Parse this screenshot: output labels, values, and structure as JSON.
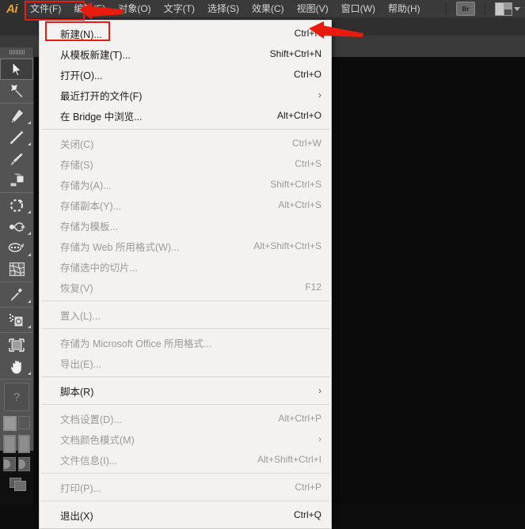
{
  "app": {
    "name": "Ai",
    "brand_color": "#f0a030",
    "highlight_color": "#e81b0e"
  },
  "menubar": {
    "items": [
      {
        "label": "文件(F)",
        "active": true
      },
      {
        "label": "编辑(E)",
        "active": false
      },
      {
        "label": "对象(O)",
        "active": false
      },
      {
        "label": "文字(T)",
        "active": false
      },
      {
        "label": "选择(S)",
        "active": false
      },
      {
        "label": "效果(C)",
        "active": false
      },
      {
        "label": "视图(V)",
        "active": false
      },
      {
        "label": "窗口(W)",
        "active": false
      },
      {
        "label": "帮助(H)",
        "active": false
      }
    ],
    "bridge_button": "Br",
    "workspace_icon": "layout-switcher-icon",
    "workspace_caret": "chevron-down-icon"
  },
  "file_menu": {
    "title": "文件(F)",
    "groups": [
      {
        "items": [
          {
            "label": "新建(N)...",
            "accel": "Ctrl+N",
            "state": "enabled",
            "submenu": false,
            "highlighted": true
          },
          {
            "label": "从模板新建(T)...",
            "accel": "Shift+Ctrl+N",
            "state": "enabled",
            "submenu": false
          },
          {
            "label": "打开(O)...",
            "accel": "Ctrl+O",
            "state": "enabled",
            "submenu": false
          },
          {
            "label": "最近打开的文件(F)",
            "accel": "",
            "state": "enabled",
            "submenu": true
          },
          {
            "label": "在 Bridge 中浏览...",
            "accel": "Alt+Ctrl+O",
            "state": "enabled",
            "submenu": false
          }
        ]
      },
      {
        "items": [
          {
            "label": "关闭(C)",
            "accel": "Ctrl+W",
            "state": "disabled",
            "submenu": false
          },
          {
            "label": "存储(S)",
            "accel": "Ctrl+S",
            "state": "disabled",
            "submenu": false
          },
          {
            "label": "存储为(A)...",
            "accel": "Shift+Ctrl+S",
            "state": "disabled",
            "submenu": false
          },
          {
            "label": "存储副本(Y)...",
            "accel": "Alt+Ctrl+S",
            "state": "disabled",
            "submenu": false
          },
          {
            "label": "存储为模板...",
            "accel": "",
            "state": "disabled",
            "submenu": false
          },
          {
            "label": "存储为 Web 所用格式(W)...",
            "accel": "Alt+Shift+Ctrl+S",
            "state": "disabled",
            "submenu": false
          },
          {
            "label": "存储选中的切片...",
            "accel": "",
            "state": "disabled",
            "submenu": false
          },
          {
            "label": "恢复(V)",
            "accel": "F12",
            "state": "disabled",
            "submenu": false
          }
        ]
      },
      {
        "items": [
          {
            "label": "置入(L)...",
            "accel": "",
            "state": "disabled",
            "submenu": false
          }
        ]
      },
      {
        "items": [
          {
            "label": "存储为 Microsoft Office 所用格式...",
            "accel": "",
            "state": "disabled",
            "submenu": false
          },
          {
            "label": "导出(E)...",
            "accel": "",
            "state": "disabled",
            "submenu": false
          }
        ]
      },
      {
        "items": [
          {
            "label": "脚本(R)",
            "accel": "",
            "state": "enabled",
            "submenu": true
          }
        ]
      },
      {
        "items": [
          {
            "label": "文档设置(D)...",
            "accel": "Alt+Ctrl+P",
            "state": "disabled",
            "submenu": false
          },
          {
            "label": "文档颜色模式(M)",
            "accel": "",
            "state": "disabled",
            "submenu": true
          },
          {
            "label": "文件信息(I)...",
            "accel": "Alt+Shift+Ctrl+I",
            "state": "disabled",
            "submenu": false
          }
        ]
      },
      {
        "items": [
          {
            "label": "打印(P)...",
            "accel": "Ctrl+P",
            "state": "disabled",
            "submenu": false
          }
        ]
      },
      {
        "items": [
          {
            "label": "退出(X)",
            "accel": "Ctrl+Q",
            "state": "enabled",
            "submenu": false
          }
        ]
      }
    ]
  },
  "toolbar": {
    "groups": [
      {
        "tools": [
          {
            "name": "selection-tool",
            "selected": true,
            "corner": false
          },
          {
            "name": "magic-wand-tool",
            "selected": false,
            "corner": false
          }
        ]
      },
      {
        "tools": [
          {
            "name": "pen-tool",
            "selected": false,
            "corner": true
          },
          {
            "name": "line-segment-tool",
            "selected": false,
            "corner": true
          },
          {
            "name": "paintbrush-tool",
            "selected": false,
            "corner": false
          },
          {
            "name": "shape-builder-tool",
            "selected": false,
            "corner": false
          }
        ]
      },
      {
        "tools": [
          {
            "name": "rotate-tool",
            "selected": false,
            "corner": true
          },
          {
            "name": "width-tool",
            "selected": false,
            "corner": true
          },
          {
            "name": "blend-tool",
            "selected": false,
            "corner": true
          },
          {
            "name": "mesh-tool",
            "selected": false,
            "corner": false
          }
        ]
      },
      {
        "tools": [
          {
            "name": "eyedropper-tool",
            "selected": false,
            "corner": true
          }
        ]
      },
      {
        "tools": [
          {
            "name": "symbol-sprayer-tool",
            "selected": false,
            "corner": true
          }
        ]
      },
      {
        "tools": [
          {
            "name": "artboard-tool",
            "selected": false,
            "corner": false
          },
          {
            "name": "hand-tool",
            "selected": false,
            "corner": true
          }
        ]
      }
    ],
    "help_icon": "question-mark-icon",
    "fill_stroke": "fill-stroke-swatches",
    "color_modes": "color-mode-buttons",
    "screen_mode": "screen-mode-button"
  },
  "annotations": {
    "file_menu_highlight": "red-rectangle-around-file-menu",
    "new_item_highlight": "red-rectangle-around-new-item",
    "arrow_menubar": "red-arrow-pointing-to-file-menu",
    "arrow_shortcut": "red-arrow-pointing-to-ctrl-n"
  }
}
